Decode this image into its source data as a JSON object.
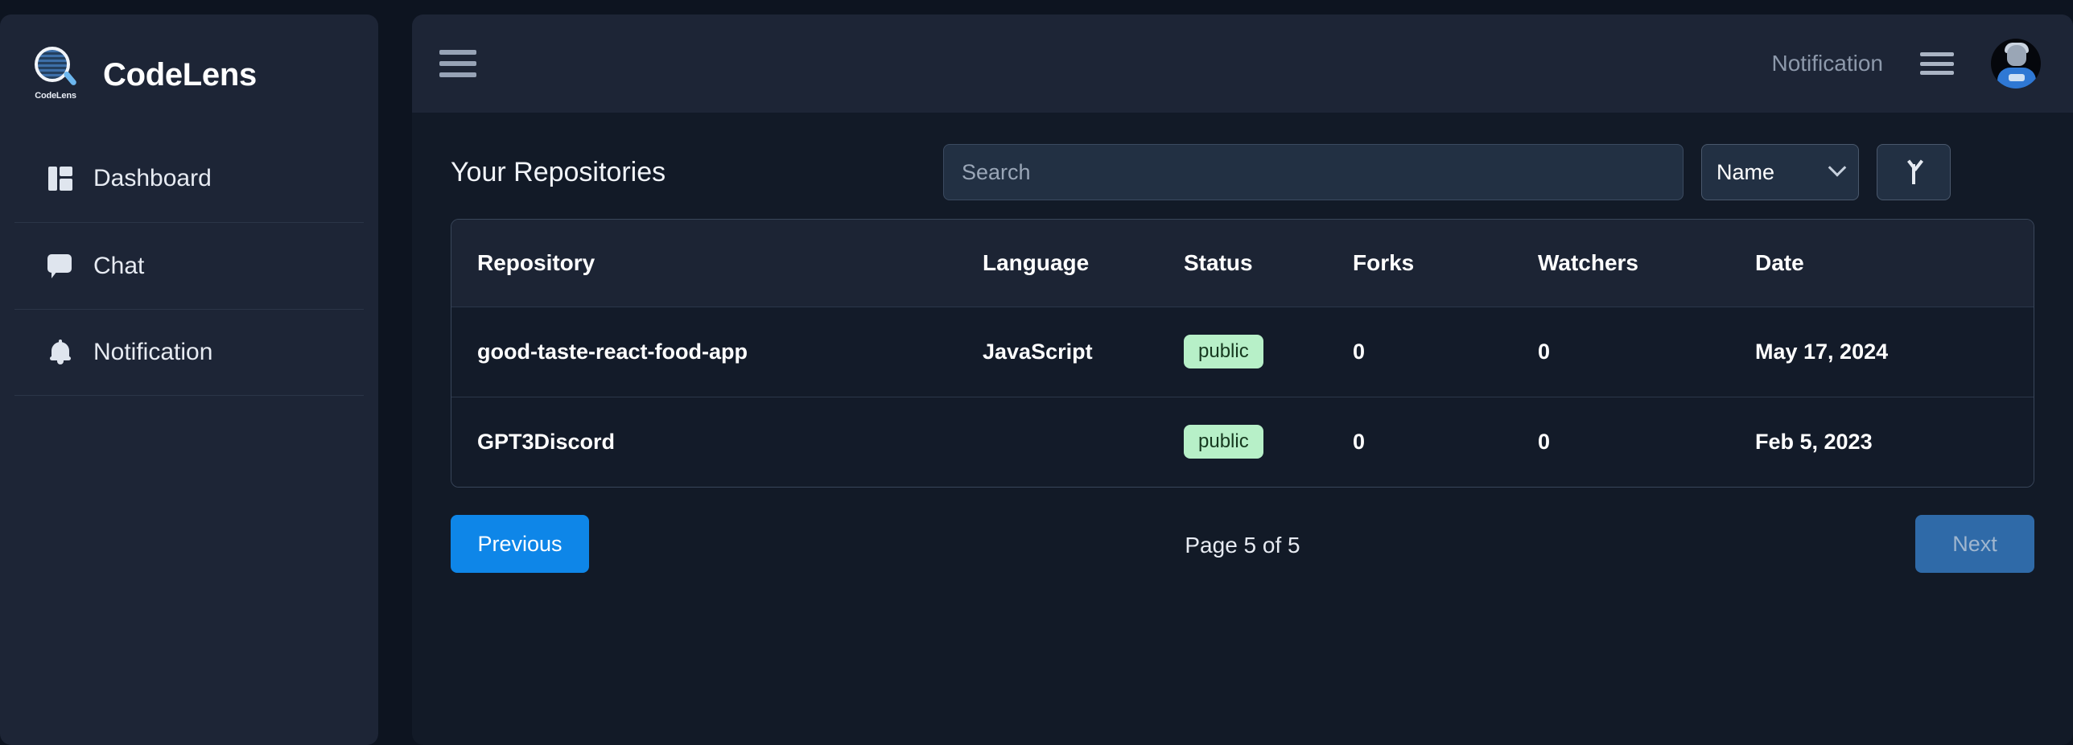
{
  "brand": {
    "name": "CodeLens",
    "logo_caption": "CodeLens",
    "logo_icon": "magnifier-logo-icon"
  },
  "sidebar": {
    "items": [
      {
        "label": "Dashboard",
        "icon": "dashboard-panels-icon"
      },
      {
        "label": "Chat",
        "icon": "chat-bubble-icon"
      },
      {
        "label": "Notification",
        "icon": "bell-icon"
      }
    ]
  },
  "topbar": {
    "menu_icon": "hamburger-menu-icon",
    "notification_label": "Notification",
    "right_menu_icon": "hamburger-menu-icon",
    "avatar_icon": "user-avatar"
  },
  "main": {
    "heading": "Your Repositories",
    "search": {
      "value": "",
      "placeholder": "Search",
      "icon": "search-input"
    },
    "sort": {
      "selected": "Name",
      "chevron_icon": "chevron-down-icon",
      "direction_icon": "arrow-up-icon"
    },
    "table": {
      "columns": [
        "Repository",
        "Language",
        "Status",
        "Forks",
        "Watchers",
        "Date"
      ],
      "rows": [
        {
          "repository": "good-taste-react-food-app",
          "language": "JavaScript",
          "status": "public",
          "forks": "0",
          "watchers": "0",
          "date": "May 17, 2024"
        },
        {
          "repository": "GPT3Discord",
          "language": "",
          "status": "public",
          "forks": "0",
          "watchers": "0",
          "date": "Feb 5, 2023"
        }
      ]
    },
    "pagination": {
      "previous_label": "Previous",
      "page_status": "Page 5 of 5",
      "next_label": "Next"
    }
  },
  "colors": {
    "accent_blue": "#0e86e8",
    "accent_blue_muted": "#2f6aa8",
    "badge_green_bg": "#b7f0c8",
    "sidebar_bg": "#1d2536",
    "content_bg": "#121a27",
    "page_bg": "#0d1420"
  }
}
